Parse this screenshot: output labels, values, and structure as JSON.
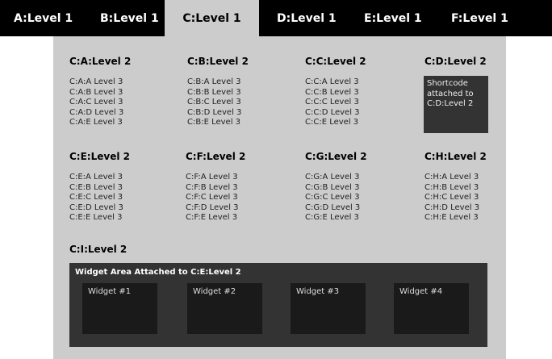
{
  "colors": {
    "nav_bg": "#000000",
    "panel_bg": "#cccccc",
    "dark_box": "#333333",
    "widget_bg": "#1a1a1a"
  },
  "nav": {
    "tabs": [
      {
        "label": "A:Level 1"
      },
      {
        "label": "B:Level 1"
      },
      {
        "label": "C:Level 1",
        "active": true
      },
      {
        "label": "D:Level 1"
      },
      {
        "label": "E:Level 1"
      },
      {
        "label": "F:Level 1"
      }
    ]
  },
  "columns": [
    {
      "title": "C:A:Level 2",
      "items": [
        "C:A:A Level 3",
        "C:A:B Level 3",
        "C:A:C Level 3",
        "C:A:D Level 3",
        "C:A:E Level 3"
      ]
    },
    {
      "title": "C:B:Level 2",
      "items": [
        "C:B:A Level 3",
        "C:B:B Level 3",
        "C:B:C Level 3",
        "C:B:D Level 3",
        "C:B:E Level 3"
      ]
    },
    {
      "title": "C:C:Level 2",
      "items": [
        "C:C:A Level 3",
        "C:C:B Level 3",
        "C:C:C Level 3",
        "C:C:D Level 3",
        "C:C:E Level 3"
      ]
    },
    {
      "title": "C:D:Level 2",
      "shortcode": [
        "Shortcode",
        "attached to",
        "C:D:Level 2"
      ]
    },
    {
      "title": "C:E:Level 2",
      "items": [
        "C:E:A Level 3",
        "C:E:B Level 3",
        "C:E:C Level 3",
        "C:E:D Level 3",
        "C:E:E Level 3"
      ]
    },
    {
      "title": "C:F:Level 2",
      "items": [
        "C:F:A Level 3",
        "C:F:B Level 3",
        "C:F:C Level 3",
        "C:F:D Level 3",
        "C:F:E Level 3"
      ]
    },
    {
      "title": "C:G:Level 2",
      "items": [
        "C:G:A Level 3",
        "C:G:B Level 3",
        "C:G:C Level 3",
        "C:G:D Level 3",
        "C:G:E Level 3"
      ]
    },
    {
      "title": "C:H:Level 2",
      "items": [
        "C:H:A Level 3",
        "C:H:B Level 3",
        "C:H:C Level 3",
        "C:H:D Level 3",
        "C:H:E Level 3"
      ]
    },
    {
      "title": "C:I:Level 2"
    }
  ],
  "widget_area": {
    "title": "Widget Area Attached to C:E:Level 2",
    "widgets": [
      {
        "label": "Widget #1"
      },
      {
        "label": "Widget #2"
      },
      {
        "label": "Widget #3"
      },
      {
        "label": "Widget #4"
      }
    ]
  }
}
